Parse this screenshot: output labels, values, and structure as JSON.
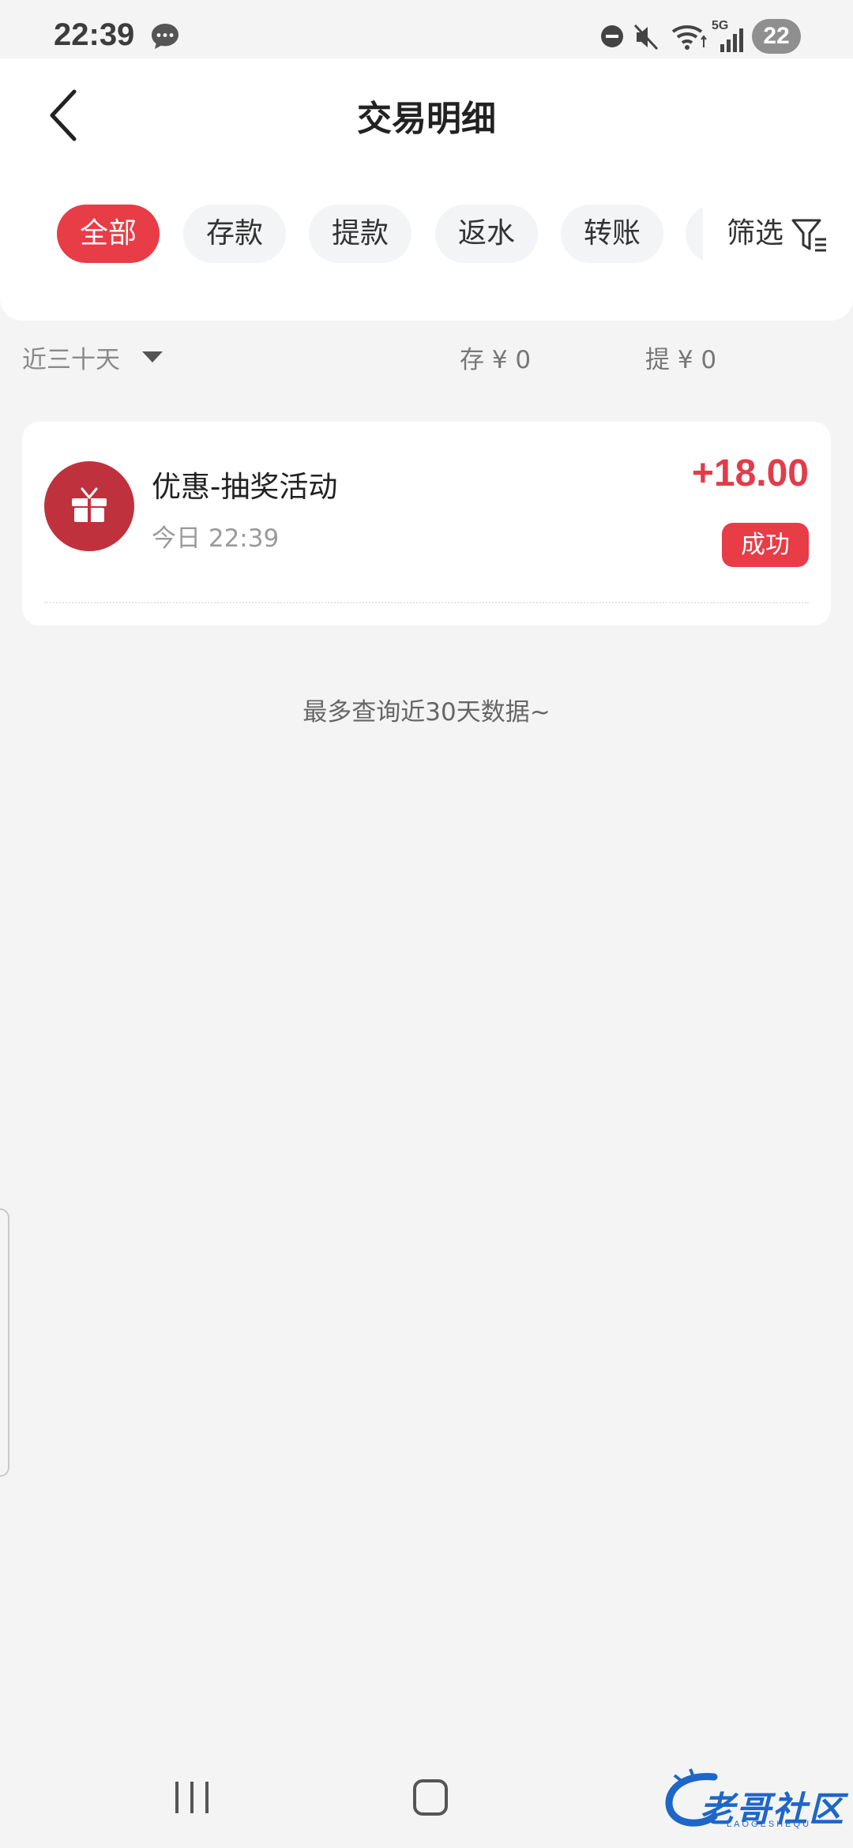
{
  "status_bar": {
    "time": "22:39",
    "network": "5G",
    "battery": "22"
  },
  "header": {
    "title": "交易明细",
    "tabs": [
      {
        "label": "全部",
        "active": true
      },
      {
        "label": "存款",
        "active": false
      },
      {
        "label": "提款",
        "active": false
      },
      {
        "label": "返水",
        "active": false
      },
      {
        "label": "转账",
        "active": false
      }
    ],
    "filter_label": "筛选"
  },
  "summary": {
    "period": "近三十天",
    "deposit_total": "存 ¥ 0",
    "withdraw_total": "提 ¥ 0"
  },
  "transactions": [
    {
      "title": "优惠-抽奖活动",
      "time": "今日 22:39",
      "amount": "+18.00",
      "status": "成功",
      "icon": "gift-icon"
    }
  ],
  "end_note": "最多查询近30天数据~",
  "watermark": {
    "text": "老哥社区",
    "sub": "LAOGESHEQU"
  },
  "colors": {
    "accent": "#e83c47",
    "amount": "#e23c48",
    "avatar": "#bf323d",
    "background": "#f4f4f4"
  }
}
